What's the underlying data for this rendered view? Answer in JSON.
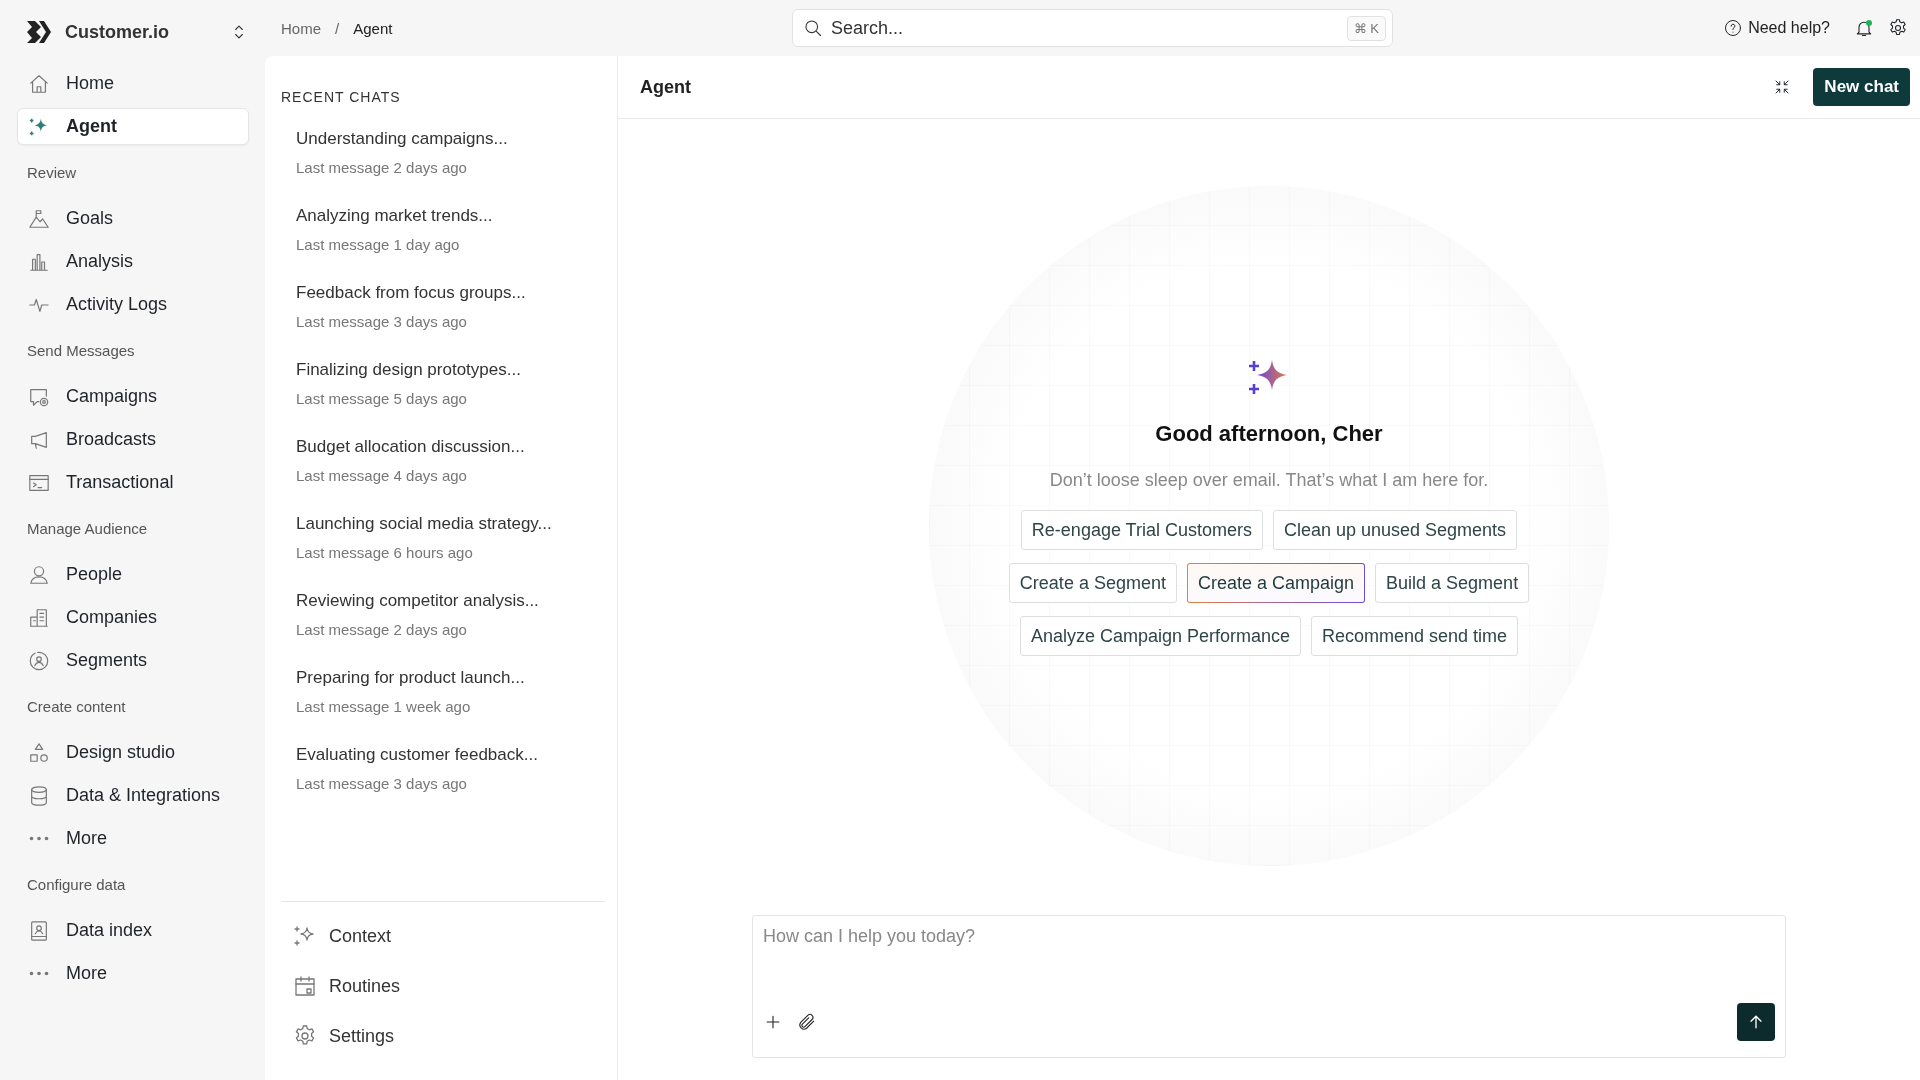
{
  "sidebar": {
    "workspace": "Customer.io",
    "sections": [
      {
        "items": [
          {
            "label": "Home",
            "selected": false
          },
          {
            "label": "Agent",
            "selected": true
          }
        ]
      },
      {
        "heading": "Review",
        "items": [
          {
            "label": "Goals",
            "selected": false
          },
          {
            "label": "Analysis",
            "selected": false
          },
          {
            "label": "Activity Logs",
            "selected": false
          }
        ]
      },
      {
        "heading": "Send Messages",
        "items": [
          {
            "label": "Campaigns",
            "selected": false
          },
          {
            "label": "Broadcasts",
            "selected": false
          },
          {
            "label": "Transactional",
            "selected": false
          }
        ]
      },
      {
        "heading": "Manage Audience",
        "items": [
          {
            "label": "People",
            "selected": false
          },
          {
            "label": "Companies",
            "selected": false
          },
          {
            "label": "Segments",
            "selected": false
          }
        ]
      },
      {
        "heading": "Create content",
        "items": [
          {
            "label": "Design studio",
            "selected": false
          },
          {
            "label": "Data & Integrations",
            "selected": false
          },
          {
            "label": "More",
            "selected": false
          }
        ]
      },
      {
        "heading": "Configure data",
        "items": [
          {
            "label": "Data index",
            "selected": false
          },
          {
            "label": "More",
            "selected": false
          }
        ]
      }
    ]
  },
  "topbar": {
    "breadcrumbs": [
      "Home",
      "Agent"
    ],
    "breadcrumb_separator": "/",
    "search": {
      "placeholder": "Search...",
      "shortcut": "⌘ K"
    },
    "help": "Need help?",
    "notifications_unread": true
  },
  "recent_chats": {
    "title": "RECENT CHATS",
    "chats": [
      {
        "title": "Understanding campaigns...",
        "meta": "Last message 2 days ago"
      },
      {
        "title": "Analyzing market trends...",
        "meta": "Last message 1 day ago"
      },
      {
        "title": "Feedback from focus groups...",
        "meta": "Last message 3 days ago"
      },
      {
        "title": "Finalizing design prototypes...",
        "meta": "Last message 5 days ago"
      },
      {
        "title": "Budget allocation discussion...",
        "meta": "Last message 4 days ago"
      },
      {
        "title": "Launching social media strategy...",
        "meta": "Last message 6 hours ago"
      },
      {
        "title": "Reviewing competitor analysis...",
        "meta": "Last message 2 days ago"
      },
      {
        "title": "Preparing for product launch...",
        "meta": "Last message 1 week ago"
      },
      {
        "title": "Evaluating customer feedback...",
        "meta": "Last message 3 days ago"
      }
    ],
    "footer_links": [
      "Context",
      "Routines",
      "Settings"
    ]
  },
  "main": {
    "title": "Agent",
    "new_chat": "New chat",
    "greeting": "Good afternoon, Cher",
    "subtitle": "Don’t loose sleep over email. That’s what I am here for.",
    "suggestion_rows": [
      [
        {
          "label": "Re-engage Trial Customers",
          "selected": false
        },
        {
          "label": "Clean up unused Segments",
          "selected": false
        }
      ],
      [
        {
          "label": "Create a Segment",
          "selected": false
        },
        {
          "label": "Create a Campaign",
          "selected": true
        },
        {
          "label": "Build a Segment",
          "selected": false
        }
      ],
      [
        {
          "label": "Analyze Campaign Performance",
          "selected": false
        },
        {
          "label": "Recommend send time",
          "selected": false
        }
      ]
    ],
    "composer": {
      "placeholder": "How can I help you today?"
    }
  }
}
